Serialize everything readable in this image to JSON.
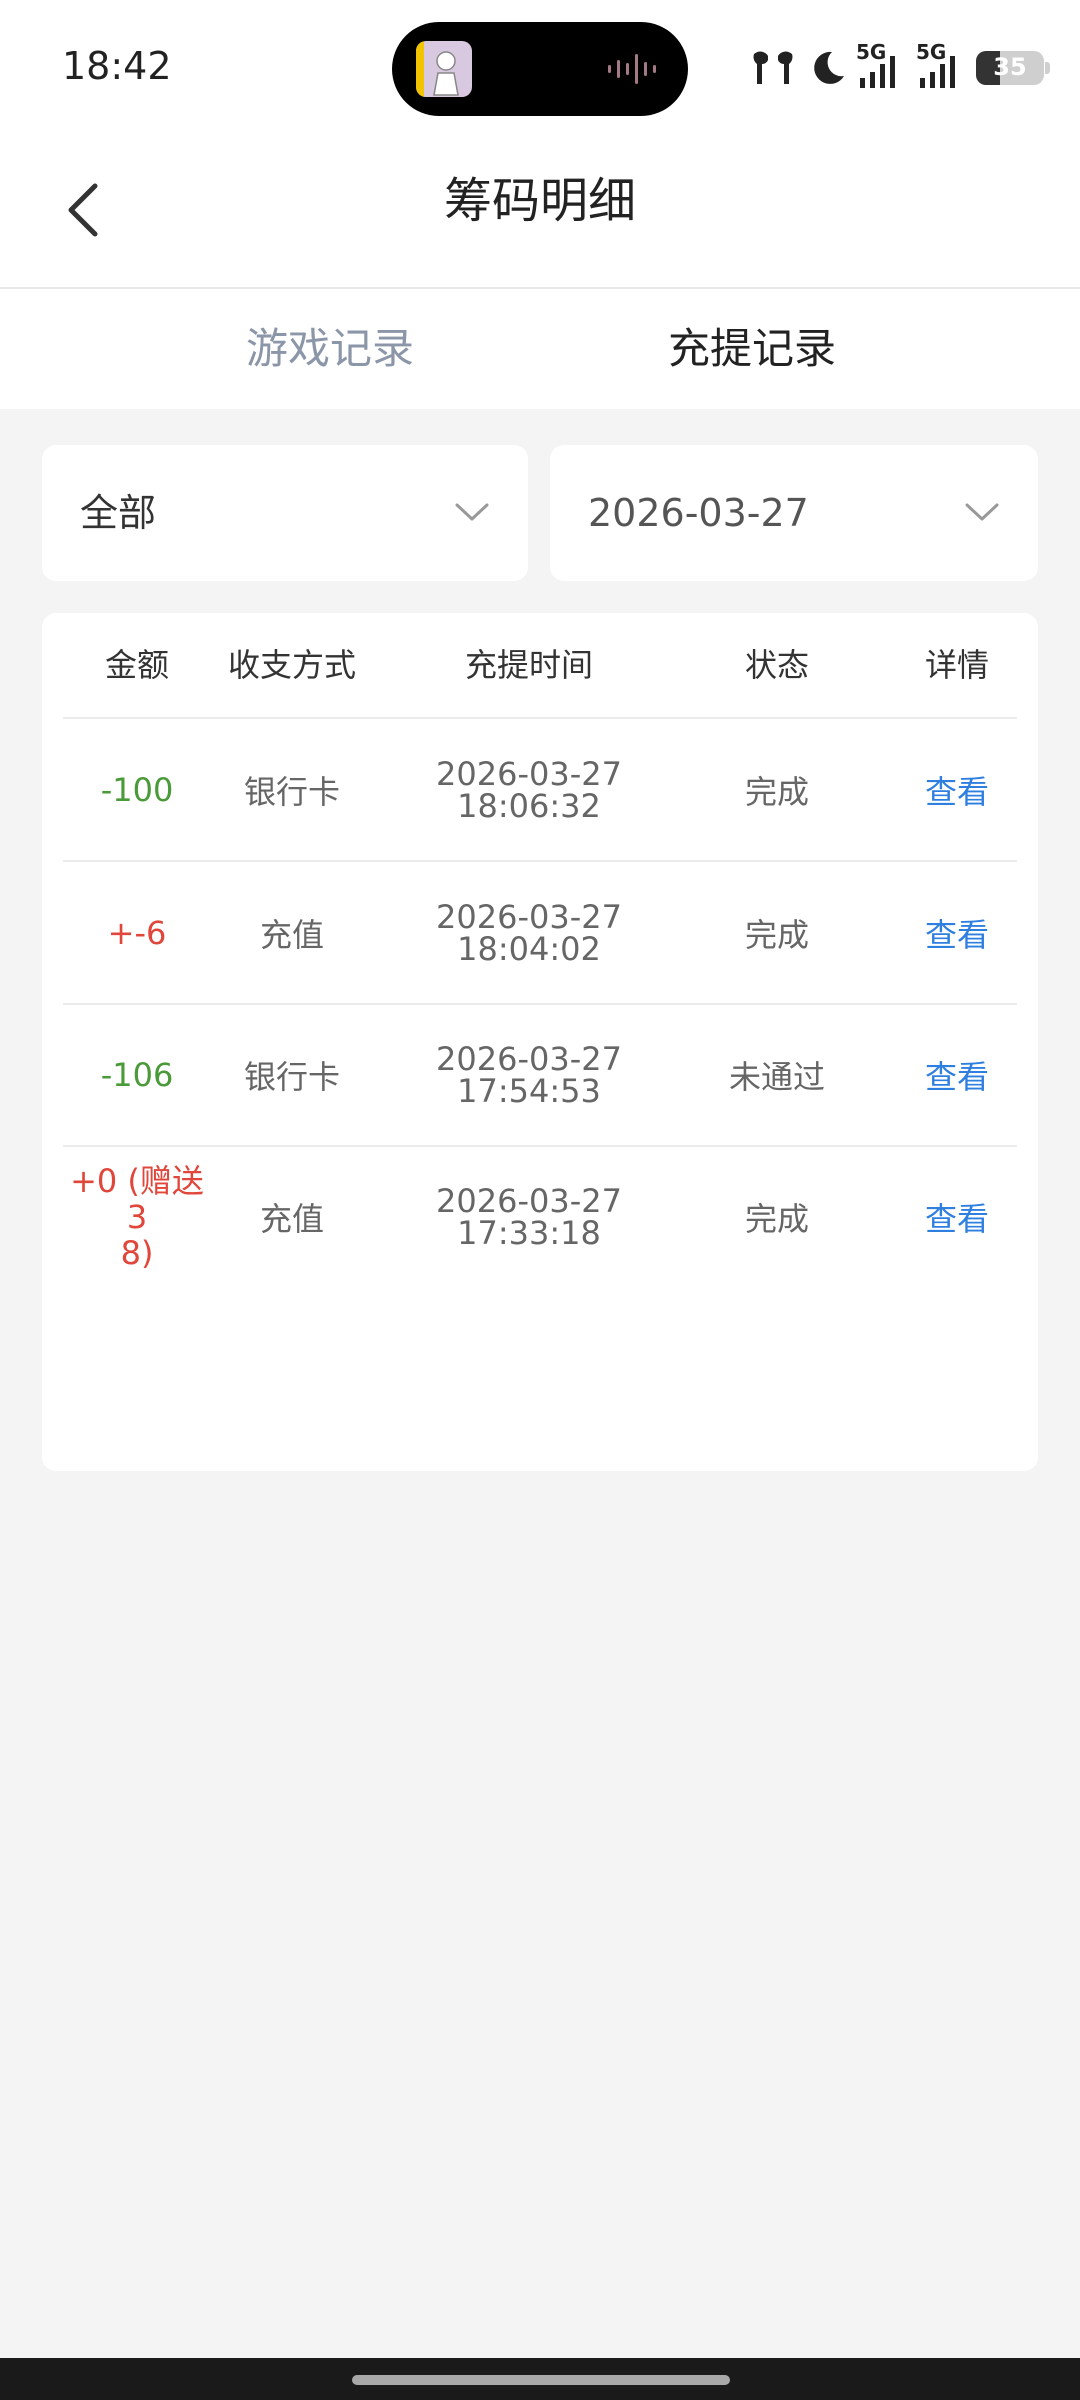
{
  "status_bar": {
    "time": "18:42",
    "network_label_1": "5G",
    "network_label_2": "5G",
    "battery": "35"
  },
  "header": {
    "title": "筹码明细"
  },
  "tabs": [
    {
      "label": "游戏记录",
      "active": false
    },
    {
      "label": "充提记录",
      "active": true
    }
  ],
  "filters": {
    "type": "全部",
    "date": "2026-03-27"
  },
  "table": {
    "headers": [
      "金额",
      "收支方式",
      "充提时间",
      "状态",
      "详情"
    ],
    "rows": [
      {
        "amount": "-100",
        "method": "银行卡",
        "date": "2026-03-27",
        "time": "18:06:32",
        "status": "完成",
        "detail": "查看"
      },
      {
        "amount": "+-6",
        "method": "充值",
        "date": "2026-03-27",
        "time": "18:04:02",
        "status": "完成",
        "detail": "查看"
      },
      {
        "amount": "-106",
        "method": "银行卡",
        "date": "2026-03-27",
        "time": "17:54:53",
        "status": "未通过",
        "detail": "查看"
      },
      {
        "amount_line1": "+0 (赠送3",
        "amount_line2": "8)",
        "method": "充值",
        "date": "2026-03-27",
        "time": "17:33:18",
        "status": "完成",
        "detail": "查看"
      }
    ]
  },
  "colors": {
    "negative": "#4a9a3a",
    "positive": "#e0463a",
    "link": "#2f7fe0",
    "tab_inactive": "#8b96a8"
  }
}
